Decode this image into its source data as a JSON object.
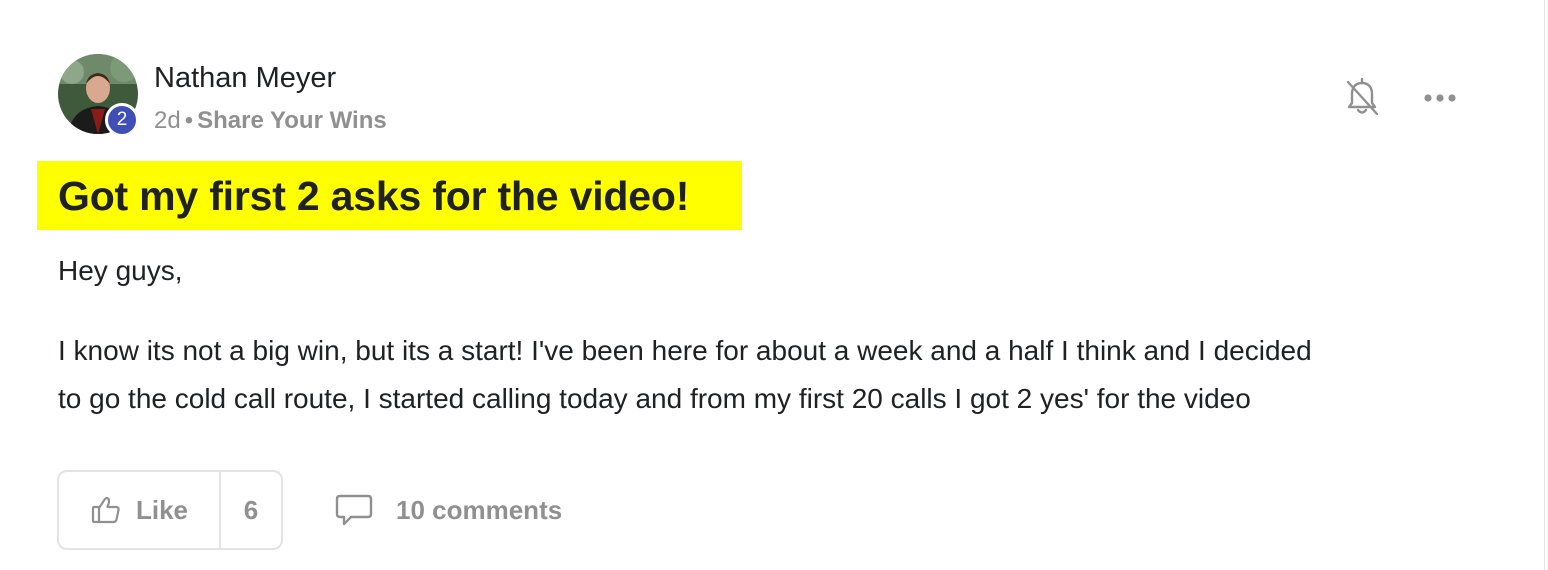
{
  "post": {
    "author": {
      "name": "Nathan Meyer",
      "level": "2"
    },
    "meta": {
      "time_ago": "2d",
      "separator": "•",
      "category": "Share Your Wins"
    },
    "title": "Got my first 2 asks for the video!",
    "body": {
      "greeting": "Hey guys,",
      "line1": "I know its not a big win, but its a start! I've been here for about a week and a half I think and I decided",
      "line2": "to go the cold call route, I started calling today and from my first 20 calls I got 2 yes' for the video"
    },
    "actions": {
      "like_label": "Like",
      "like_count": "6",
      "comments_label": "10 comments"
    },
    "icons": {
      "bell": "bell-off-icon",
      "more": "more-horizontal-icon",
      "like": "thumbs-up-icon",
      "comments": "comment-bubble-icon"
    },
    "colors": {
      "title_highlight": "#ffff00",
      "level_badge": "#3f4fb5",
      "muted_text": "#909090"
    }
  }
}
